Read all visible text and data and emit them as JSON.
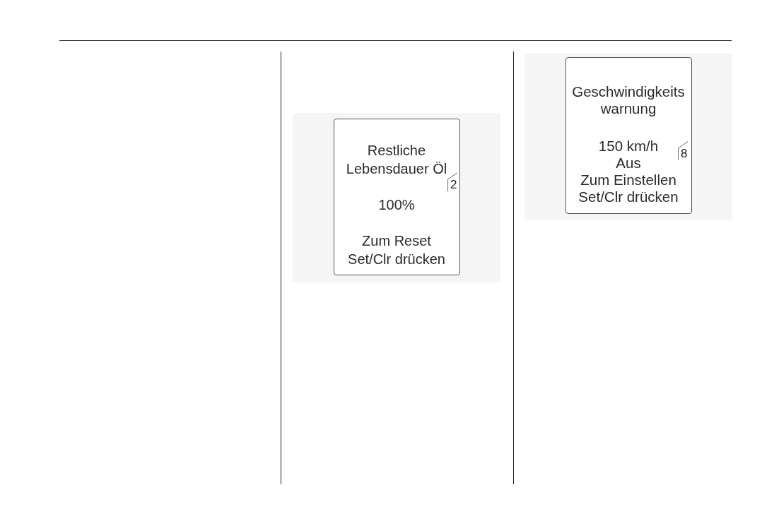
{
  "figures": [
    {
      "display": {
        "groups": [
          {
            "lines": [
              "Restliche",
              "Lebensdauer Öl"
            ]
          },
          {
            "lines": [
              "100%"
            ]
          },
          {
            "lines": [
              "Zum Reset",
              "Set/Clr drücken"
            ]
          }
        ]
      },
      "tag": "2"
    },
    {
      "display": {
        "groups": [
          {
            "lines": [
              "Geschwindigkeits",
              "warnung"
            ]
          },
          {
            "lines": [
              "150 km/h",
              "Aus",
              "Zum Einstellen",
              "Set/Clr drücken"
            ]
          }
        ]
      },
      "tag": "8"
    }
  ]
}
